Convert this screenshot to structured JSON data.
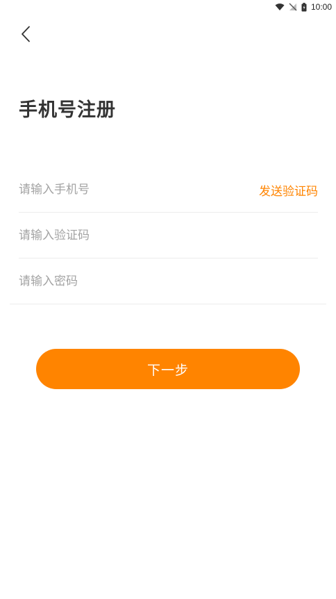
{
  "status_bar": {
    "time": "10:00",
    "icons": [
      "wifi-icon",
      "no-signal-icon",
      "battery-icon"
    ]
  },
  "header": {
    "back_icon": "chevron-left-icon"
  },
  "page": {
    "title": "手机号注册"
  },
  "form": {
    "phone": {
      "placeholder": "请输入手机号",
      "value": ""
    },
    "send_code_label": "发送验证码",
    "code": {
      "placeholder": "请输入验证码",
      "value": ""
    },
    "password": {
      "placeholder": "请输入密码",
      "value": ""
    }
  },
  "actions": {
    "next_label": "下一步"
  },
  "colors": {
    "accent": "#ff8400",
    "title": "#333333",
    "placeholder": "#a3a3a3",
    "divider": "#ececec",
    "background": "#ffffff"
  }
}
